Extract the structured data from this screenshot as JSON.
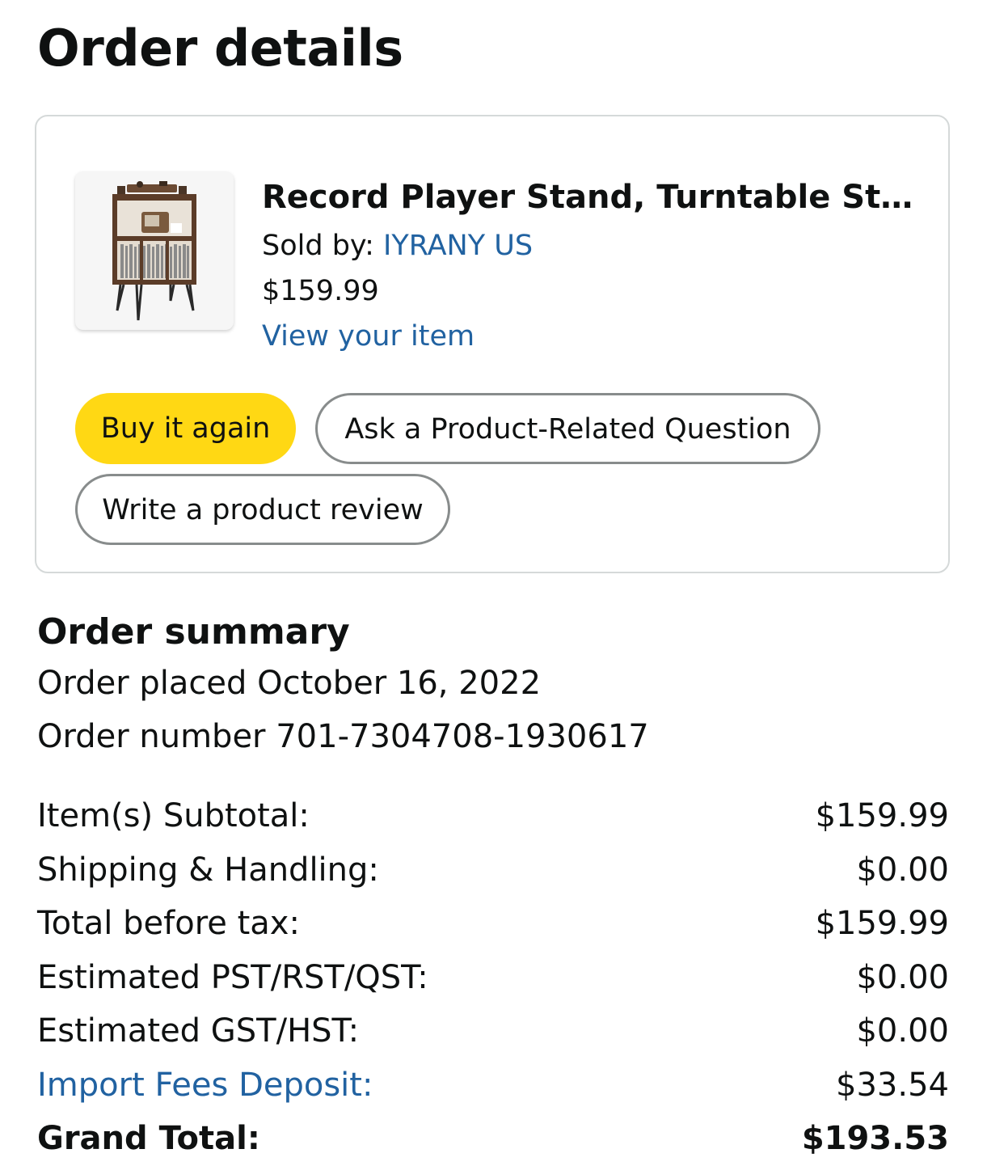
{
  "page": {
    "title": "Order details"
  },
  "item": {
    "title": "Record Player Stand, Turntable Stan...",
    "sold_by_label": "Sold by: ",
    "seller": "IYRANY US",
    "price": "$159.99",
    "view_link": "View your item",
    "image_icon": "record-player-stand-product-image"
  },
  "actions": {
    "buy_again": "Buy it again",
    "ask_question": "Ask a Product-Related Question",
    "write_review": "Write a product review"
  },
  "summary": {
    "title": "Order summary",
    "order_placed": "Order placed October 16, 2022",
    "order_number": "Order number 701-7304708-1930617"
  },
  "totals": [
    {
      "label": "Item(s) Subtotal:",
      "value": "$159.99"
    },
    {
      "label": "Shipping & Handling:",
      "value": "$0.00"
    },
    {
      "label": "Total before tax:",
      "value": "$159.99"
    },
    {
      "label": "Estimated PST/RST/QST:",
      "value": "$0.00"
    },
    {
      "label": "Estimated GST/HST:",
      "value": "$0.00"
    },
    {
      "label": "Import Fees Deposit:",
      "value": "$33.54"
    },
    {
      "label": "Grand Total:",
      "value": "$193.53"
    }
  ],
  "colors": {
    "link": "#2162a1",
    "primary_button": "#ffd814",
    "card_border": "#d5d9d9",
    "secondary_button_border": "#888c8c"
  }
}
